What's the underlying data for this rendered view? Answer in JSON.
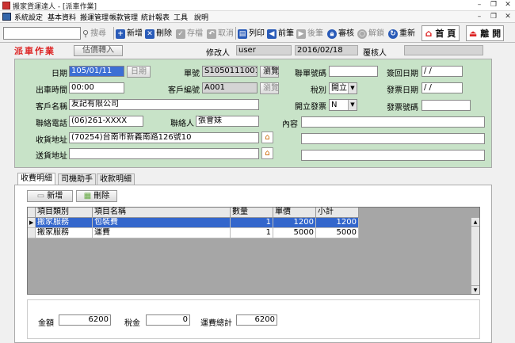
{
  "window": {
    "title": "搬家貨運達人 - [派車作業]"
  },
  "menu": [
    "系統設定",
    "基本資料",
    "搬運管理",
    "帳款管理",
    "統計報表",
    "工具",
    "說明"
  ],
  "toolbar": {
    "search_value": "",
    "search_btn": "搜尋",
    "add": "新增",
    "delete": "刪除",
    "save": "存檔",
    "cancel": "取消",
    "print": "列印",
    "prev": "前筆",
    "next": "後筆",
    "review": "審核",
    "unlock": "解鎖",
    "refresh": "重新",
    "home": "首 頁",
    "exit": "離 開"
  },
  "header": {
    "title": "派車作業",
    "transfer_btn": "估價轉入",
    "modifier_label": "修改人",
    "modifier_value": "user",
    "modified_date": "2016/02/18",
    "reviewer_label": "覆核人",
    "reviewer_value": ""
  },
  "form": {
    "date_label": "日期",
    "date_value": "105/01/11",
    "date_btn": "日期",
    "sheet_no_label": "單號",
    "sheet_no_value": "S1050111001",
    "browse_btn": "瀏覽",
    "contact_no_label": "聯單號碼",
    "contact_no_value": "",
    "return_date_label": "簽回日期",
    "return_date_value": " / /",
    "depart_time_label": "出車時間",
    "depart_time_value": "00:00",
    "customer_code_label": "客戶編號",
    "customer_code_value": "A001",
    "browse_btn2": "瀏覽",
    "tax_label": "稅別",
    "tax_value": "開立",
    "invoice_date_label": "發票日期",
    "invoice_date_value": " / /",
    "customer_name_label": "客戶名稱",
    "customer_name_value": "友記有限公司",
    "issue_invoice_label": "開立發票",
    "issue_invoice_value": "N",
    "invoice_no_label": "發票號碼",
    "invoice_no_value": "",
    "phone_label": "聯絡電話",
    "phone_value": "(06)261-XXXX",
    "contact_label": "聯絡人",
    "contact_value": "張會妹",
    "content_label": "內容",
    "content_value": "",
    "pickup_label": "收貨地址",
    "pickup_value": "(70254)台南市新義南路126號10",
    "delivery_label": "送貨地址",
    "delivery_value": ""
  },
  "tabs": [
    "收費明細",
    "司機助手",
    "收款明細"
  ],
  "detail": {
    "add_btn": "新增",
    "delete_btn": "刪除",
    "columns": [
      "項目類別",
      "項目名稱",
      "數量",
      "單價",
      "小計"
    ],
    "rows": [
      {
        "category": "搬家服務",
        "name": "包裝費",
        "qty": "1",
        "price": "1200",
        "subtotal": "1200"
      },
      {
        "category": "搬家服務",
        "name": "運費",
        "qty": "1",
        "price": "5000",
        "subtotal": "5000"
      }
    ]
  },
  "totals": {
    "amount_label": "金額",
    "amount_value": "6200",
    "tax_label": "稅金",
    "tax_value": "0",
    "grand_label": "運費總計",
    "grand_value": "6200"
  }
}
